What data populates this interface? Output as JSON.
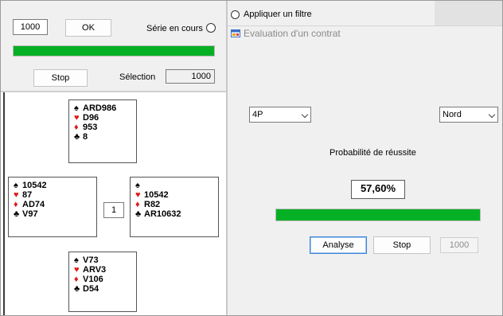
{
  "left_panel": {
    "count_value": "1000",
    "ok_label": "OK",
    "serie_label": "Série en cours",
    "progress_fraction": 1.0,
    "stop_label": "Stop",
    "selection_label": "Sélection",
    "selection_value": "1000"
  },
  "hands": {
    "north": {
      "spades": "ARD986",
      "hearts": "D96",
      "diamonds": "953",
      "clubs": "8"
    },
    "west": {
      "spades": "10542",
      "hearts": "87",
      "diamonds": "AD74",
      "clubs": "V97"
    },
    "east": {
      "spades": "",
      "hearts": "10542",
      "diamonds": "R82",
      "clubs": "AR10632"
    },
    "south": {
      "spades": "V73",
      "hearts": "ARV3",
      "diamonds": "V106",
      "clubs": "D54"
    },
    "center_value": "1"
  },
  "suit_symbols": {
    "spades": "♠",
    "hearts": "♥",
    "diamonds": "♦",
    "clubs": "♣"
  },
  "suit_colors": {
    "red": "#e01818",
    "black": "#000000"
  },
  "filter": {
    "label": "Appliquer un filtre"
  },
  "dialog": {
    "title": "Evaluation d'un contrat",
    "contract_value": "4P",
    "declarer_value": "Nord",
    "prob_label": "Probabilité de réussite",
    "prob_value": "57,60%",
    "progress_fraction": 1.0,
    "analyse_label": "Analyse",
    "stop_label": "Stop",
    "count_value": "1000"
  },
  "colors": {
    "progress_green": "#06b025",
    "panel_bg": "#f0f0f0"
  },
  "icons": {
    "title_icon": "form-window-icon"
  }
}
